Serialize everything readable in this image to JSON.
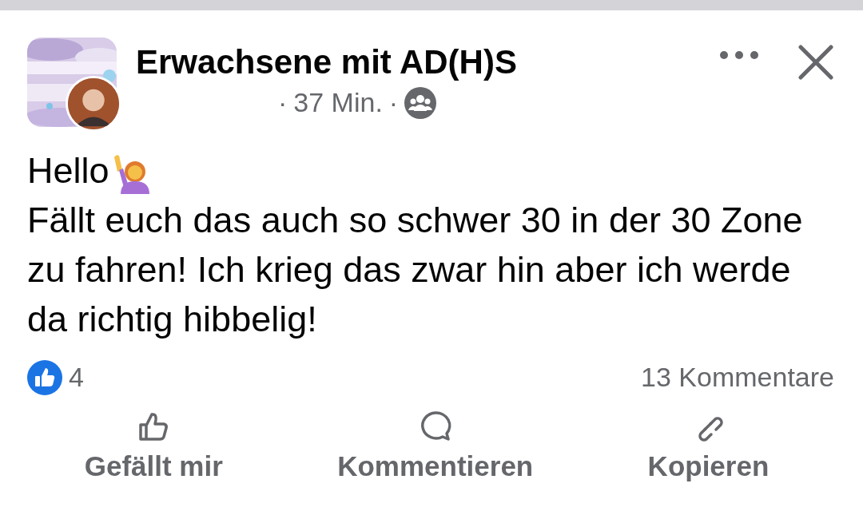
{
  "post": {
    "group_name": "Erwachsene mit AD(H)S",
    "time": "37 Min.",
    "separator": "·",
    "greeting": "Hello",
    "body": "Fällt euch das auch so schwer 30 in der 30 Zone zu fahren! Ich krieg das zwar hin aber ich werde da richtig hibbelig!"
  },
  "reactions": {
    "count": "4",
    "comments": "13 Kommentare"
  },
  "actions": [
    {
      "kind": "like",
      "label": "Gefällt mir"
    },
    {
      "kind": "comment",
      "label": "Kommentieren"
    },
    {
      "kind": "copy",
      "label": "Kopieren"
    }
  ]
}
